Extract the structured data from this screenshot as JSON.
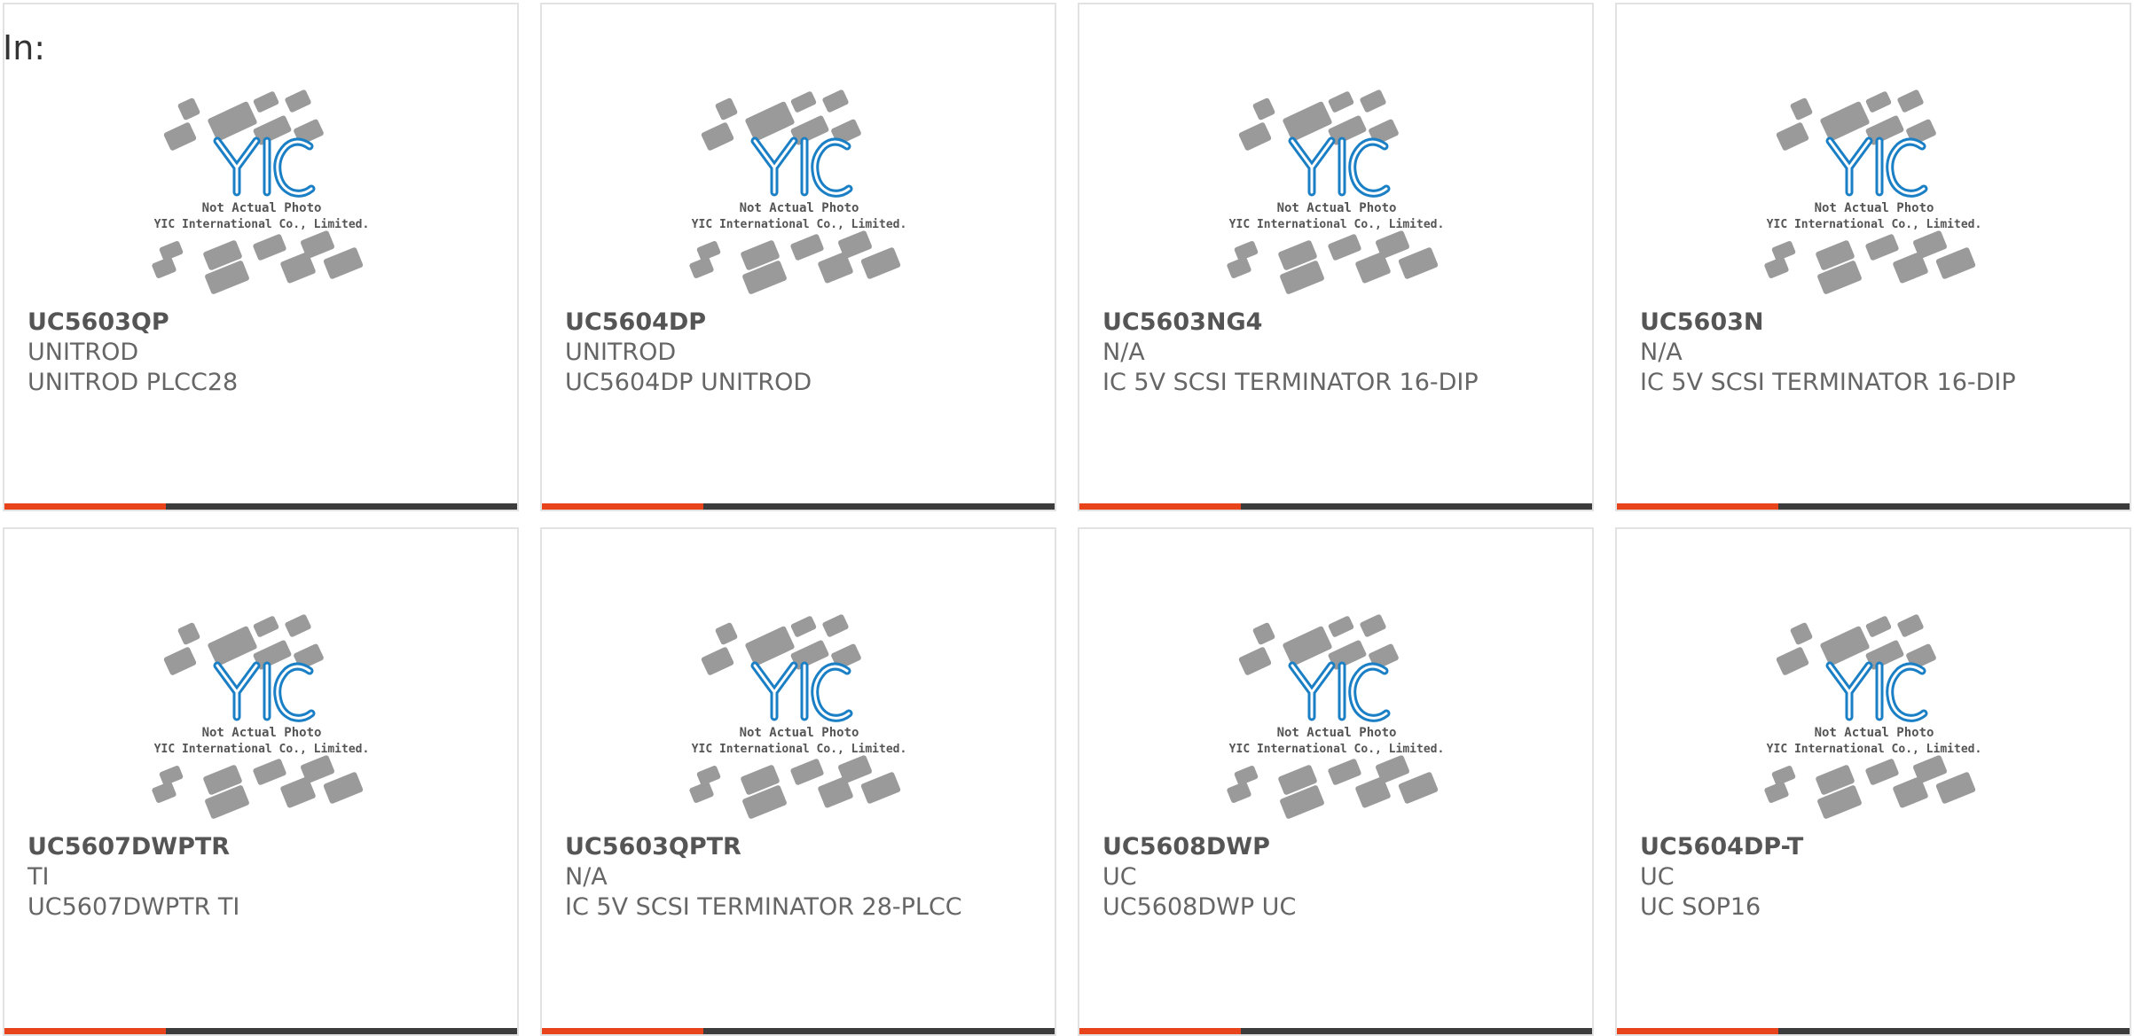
{
  "page": {
    "prefix_label": "In:"
  },
  "placeholder": {
    "line1": "Not Actual Photo",
    "line2": "YIC International Co., Limited.",
    "logo_text": "YIC"
  },
  "colors": {
    "accent": "#e8431a",
    "bar_dark": "#3c3c3c",
    "logo_blue": "#1a7fc4",
    "chip_gray": "#9a9a9a"
  },
  "products": [
    {
      "part_number": "UC5603QP",
      "manufacturer": "UNITROD",
      "description": "UNITROD PLCC28"
    },
    {
      "part_number": "UC5604DP",
      "manufacturer": "UNITROD",
      "description": "UC5604DP UNITROD"
    },
    {
      "part_number": "UC5603NG4",
      "manufacturer": "N/A",
      "description": "IC 5V SCSI TERMINATOR 16-DIP"
    },
    {
      "part_number": "UC5603N",
      "manufacturer": "N/A",
      "description": "IC 5V SCSI TERMINATOR 16-DIP"
    },
    {
      "part_number": "UC5607DWPTR",
      "manufacturer": "TI",
      "description": "UC5607DWPTR TI"
    },
    {
      "part_number": "UC5603QPTR",
      "manufacturer": "N/A",
      "description": "IC 5V SCSI TERMINATOR 28-PLCC"
    },
    {
      "part_number": "UC5608DWP",
      "manufacturer": "UC",
      "description": "UC5608DWP UC"
    },
    {
      "part_number": "UC5604DP-T",
      "manufacturer": "UC",
      "description": "UC SOP16"
    }
  ]
}
